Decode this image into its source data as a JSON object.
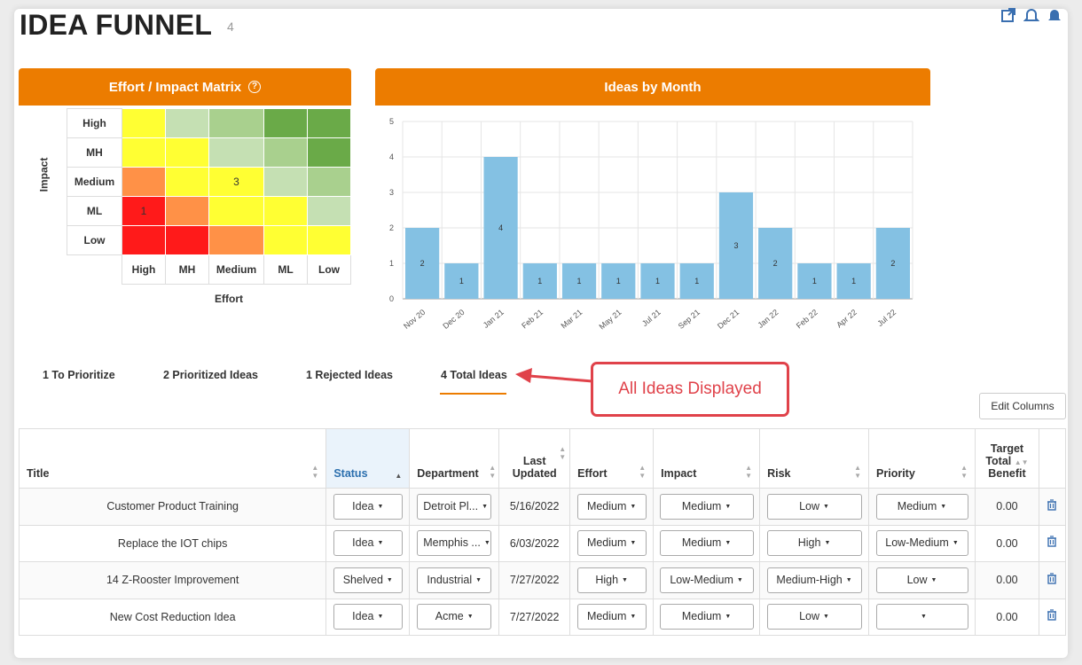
{
  "page": {
    "title": "IDEA FUNNEL",
    "count": "4"
  },
  "icons": {
    "export": "external-link-icon",
    "alert": "bell-outline-icon",
    "notify": "bell-icon"
  },
  "matrix": {
    "header": "Effort / Impact Matrix",
    "help_glyph": "?",
    "impact_label": "Impact",
    "effort_label": "Effort",
    "rows": [
      "High",
      "MH",
      "Medium",
      "ML",
      "Low"
    ],
    "cols": [
      "High",
      "MH",
      "Medium",
      "ML",
      "Low"
    ],
    "cells": [
      [
        {
          "color": "#ffff33",
          "text": ""
        },
        {
          "color": "#c5e0b3",
          "text": ""
        },
        {
          "color": "#a9d08e",
          "text": ""
        },
        {
          "color": "#6aaa48",
          "text": ""
        },
        {
          "color": "#6aaa48",
          "text": ""
        }
      ],
      [
        {
          "color": "#ffff33",
          "text": ""
        },
        {
          "color": "#ffff33",
          "text": ""
        },
        {
          "color": "#c5e0b3",
          "text": ""
        },
        {
          "color": "#a9d08e",
          "text": ""
        },
        {
          "color": "#6aaa48",
          "text": ""
        }
      ],
      [
        {
          "color": "#ff9147",
          "text": ""
        },
        {
          "color": "#ffff33",
          "text": ""
        },
        {
          "color": "#ffff33",
          "text": "3"
        },
        {
          "color": "#c5e0b3",
          "text": ""
        },
        {
          "color": "#a9d08e",
          "text": ""
        }
      ],
      [
        {
          "color": "#ff1a1a",
          "text": "1"
        },
        {
          "color": "#ff9147",
          "text": ""
        },
        {
          "color": "#ffff33",
          "text": ""
        },
        {
          "color": "#ffff33",
          "text": ""
        },
        {
          "color": "#c5e0b3",
          "text": ""
        }
      ],
      [
        {
          "color": "#ff1a1a",
          "text": ""
        },
        {
          "color": "#ff1a1a",
          "text": ""
        },
        {
          "color": "#ff9147",
          "text": ""
        },
        {
          "color": "#ffff33",
          "text": ""
        },
        {
          "color": "#ffff33",
          "text": ""
        }
      ]
    ]
  },
  "chart_data": {
    "type": "bar",
    "title": "Ideas by Month",
    "categories": [
      "Nov 20",
      "Dec 20",
      "Jan 21",
      "Feb 21",
      "Mar 21",
      "May 21",
      "Jul 21",
      "Sep 21",
      "Dec 21",
      "Jan 22",
      "Feb 22",
      "Apr 22",
      "Jul 22"
    ],
    "values": [
      2,
      1,
      4,
      1,
      1,
      1,
      1,
      1,
      3,
      2,
      1,
      1,
      2
    ],
    "ylim": [
      0,
      5
    ],
    "yticks": [
      0,
      1,
      2,
      3,
      4,
      5
    ],
    "grid": true,
    "bar_color": "#84c1e3"
  },
  "tabs": [
    {
      "label": "1 To Prioritize"
    },
    {
      "label": "2 Prioritized Ideas"
    },
    {
      "label": "1 Rejected Ideas"
    },
    {
      "label": "4 Total Ideas"
    }
  ],
  "callout": {
    "text": "All Ideas Displayed"
  },
  "edit_columns": "Edit Columns",
  "table": {
    "columns": {
      "title": "Title",
      "status": "Status",
      "department": "Department",
      "last_updated_1": "Last",
      "last_updated_2": "Updated",
      "effort": "Effort",
      "impact": "Impact",
      "risk": "Risk",
      "priority": "Priority",
      "target_1": "Target",
      "target_2": "Total",
      "target_3": "Benefit"
    },
    "rows": [
      {
        "title": "Customer Product Training",
        "status": "Idea",
        "department": "Detroit Pl...",
        "updated": "5/16/2022",
        "effort": "Medium",
        "impact": "Medium",
        "risk": "Low",
        "priority": "Medium",
        "benefit": "0.00"
      },
      {
        "title": "Replace the IOT chips",
        "status": "Idea",
        "department": "Memphis ...",
        "updated": "6/03/2022",
        "effort": "Medium",
        "impact": "Medium",
        "risk": "High",
        "priority": "Low-Medium",
        "benefit": "0.00"
      },
      {
        "title": "14 Z-Rooster Improvement",
        "status": "Shelved",
        "department": "Industrial",
        "updated": "7/27/2022",
        "effort": "High",
        "impact": "Low-Medium",
        "risk": "Medium-High",
        "priority": "Low",
        "benefit": "0.00"
      },
      {
        "title": "New Cost Reduction Idea",
        "status": "Idea",
        "department": "Acme",
        "updated": "7/27/2022",
        "effort": "Medium",
        "impact": "Medium",
        "risk": "Low",
        "priority": "",
        "benefit": "0.00"
      }
    ]
  }
}
